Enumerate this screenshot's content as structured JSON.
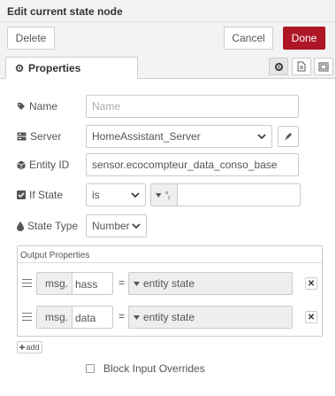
{
  "dialog": {
    "title": "Edit current state node",
    "delete_label": "Delete",
    "cancel_label": "Cancel",
    "done_label": "Done"
  },
  "tabs": [
    {
      "label": "Properties",
      "icon": "gear-icon"
    }
  ],
  "tab_icons": [
    "gear-icon",
    "document-icon",
    "frame-icon"
  ],
  "form": {
    "name": {
      "label": "Name",
      "icon": "tag-icon",
      "value": "",
      "placeholder": "Name"
    },
    "server": {
      "label": "Server",
      "icon": "server-icon",
      "value": "HomeAssistant_Server"
    },
    "entity_id": {
      "label": "Entity ID",
      "icon": "cube-icon",
      "value": "sensor.ecocompteur_data_conso_base"
    },
    "if_state": {
      "label": "If State",
      "icon": "checkbox-icon",
      "operator": "is",
      "type_glyph": "a z",
      "value": ""
    },
    "state_type": {
      "label": "State Type",
      "icon": "tint-icon",
      "value": "Number"
    }
  },
  "output_properties": {
    "legend": "Output Properties",
    "rows": [
      {
        "type": "msg.",
        "property": "hass",
        "equals": "=",
        "value": "entity state"
      },
      {
        "type": "msg.",
        "property": "data",
        "equals": "=",
        "value": "entity state"
      }
    ],
    "add_label": "add"
  },
  "block_input_overrides": {
    "label": "Block Input Overrides",
    "checked": false
  },
  "colors": {
    "primary": "#ad1625",
    "background": "#f3f3f3"
  }
}
